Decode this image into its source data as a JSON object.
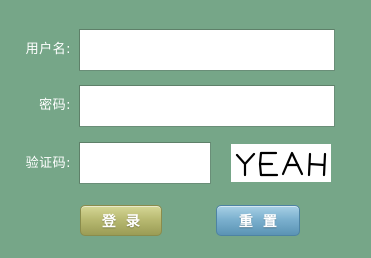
{
  "form": {
    "username_label": "用户名:",
    "username_value": "",
    "password_label": "密码:",
    "password_value": "",
    "captcha_label": "验证码:",
    "captcha_value": "",
    "captcha_image_text": "YEAH",
    "login_button": "登录",
    "reset_button": "重置"
  },
  "colors": {
    "background": "#76a688",
    "login_button": "#b9ba72",
    "reset_button": "#7cb1cf"
  }
}
